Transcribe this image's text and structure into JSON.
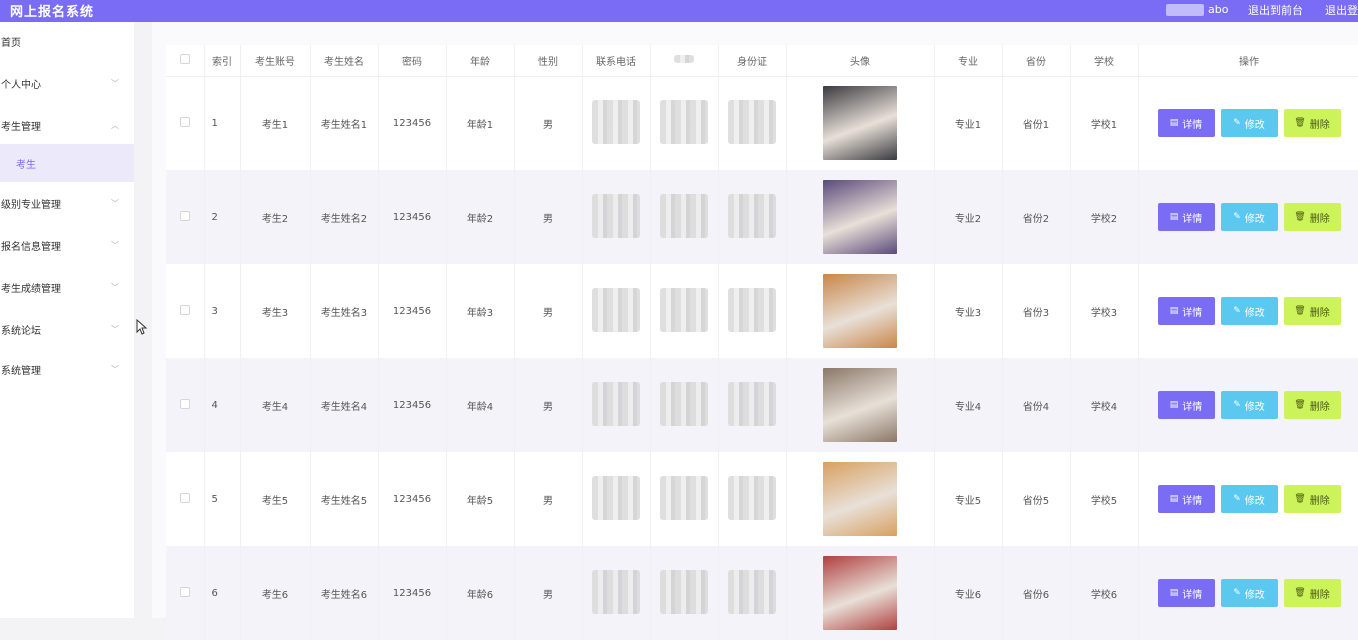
{
  "header": {
    "app_title": "网上报名系统",
    "user_suffix": "abo",
    "back_to_front": "退出到前台",
    "logout": "退出登"
  },
  "sidebar": {
    "items": [
      {
        "label": "首页",
        "expandable": false
      },
      {
        "label": "个人中心",
        "expandable": true
      },
      {
        "label": "考生管理",
        "expandable": true,
        "expanded": true
      },
      {
        "label": "考生",
        "sub": true,
        "active": true
      },
      {
        "label": "级别专业管理",
        "expandable": true
      },
      {
        "label": "报名信息管理",
        "expandable": true
      },
      {
        "label": "考生成绩管理",
        "expandable": true
      },
      {
        "label": "系统论坛",
        "expandable": true
      },
      {
        "label": "系统管理",
        "expandable": true
      }
    ]
  },
  "table": {
    "columns": [
      "",
      "索引",
      "考生账号",
      "考生姓名",
      "密码",
      "年龄",
      "性别",
      "联系电话",
      "",
      "身份证",
      "头像",
      "专业",
      "省份",
      "学校",
      "操作"
    ],
    "actions": {
      "detail": "详情",
      "edit": "修改",
      "delete": "删除"
    },
    "rows": [
      {
        "index": "1",
        "account": "考生1",
        "name": "考生姓名1",
        "password": "123456",
        "age": "年龄1",
        "gender": "男",
        "major": "专业1",
        "province": "省份1",
        "school": "学校1",
        "avatar_color": "#3a3a40"
      },
      {
        "index": "2",
        "account": "考生2",
        "name": "考生姓名2",
        "password": "123456",
        "age": "年龄2",
        "gender": "男",
        "major": "专业2",
        "province": "省份2",
        "school": "学校2",
        "avatar_color": "#5a4a7a"
      },
      {
        "index": "3",
        "account": "考生3",
        "name": "考生姓名3",
        "password": "123456",
        "age": "年龄3",
        "gender": "男",
        "major": "专业3",
        "province": "省份3",
        "school": "学校3",
        "avatar_color": "#c9864a"
      },
      {
        "index": "4",
        "account": "考生4",
        "name": "考生姓名4",
        "password": "123456",
        "age": "年龄4",
        "gender": "男",
        "major": "专业4",
        "province": "省份4",
        "school": "学校4",
        "avatar_color": "#8a7868"
      },
      {
        "index": "5",
        "account": "考生5",
        "name": "考生姓名5",
        "password": "123456",
        "age": "年龄5",
        "gender": "男",
        "major": "专业5",
        "province": "省份5",
        "school": "学校5",
        "avatar_color": "#d8a060"
      },
      {
        "index": "6",
        "account": "考生6",
        "name": "考生姓名6",
        "password": "123456",
        "age": "年龄6",
        "gender": "男",
        "major": "专业6",
        "province": "省份6",
        "school": "学校6",
        "avatar_color": "#b04040"
      }
    ]
  },
  "colors": {
    "primary": "#7b6cf6",
    "edit": "#5bc8f0",
    "delete": "#cdf35a"
  }
}
